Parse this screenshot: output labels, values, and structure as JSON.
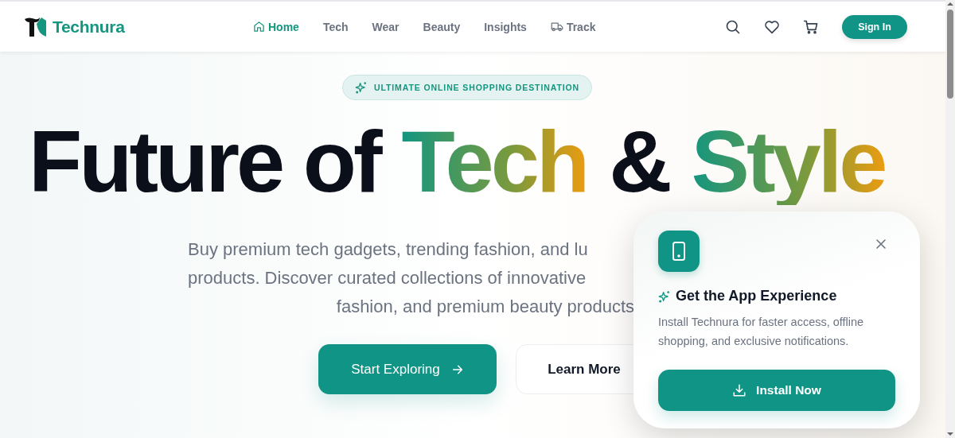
{
  "header": {
    "logo_text": "Technura",
    "nav": [
      {
        "label": "Home",
        "kind": "home",
        "selected": true
      },
      {
        "label": "Tech",
        "kind": "plain",
        "selected": false
      },
      {
        "label": "Wear",
        "kind": "plain",
        "selected": false
      },
      {
        "label": "Beauty",
        "kind": "plain",
        "selected": false
      },
      {
        "label": "Insights",
        "kind": "plain",
        "selected": false
      },
      {
        "label": "Track",
        "kind": "track",
        "selected": false
      }
    ],
    "sign_in": "Sign In"
  },
  "hero": {
    "badge": "ULTIMATE ONLINE SHOPPING DESTINATION",
    "title": [
      {
        "text": "Future of",
        "kind": "plain"
      },
      {
        "text": "Tech",
        "kind": "gradient"
      },
      {
        "text": "&",
        "kind": "plain"
      },
      {
        "text": "Style",
        "kind": "gradient"
      }
    ],
    "description_lines": [
      "Buy premium tech gadgets, trending fashion, and lu",
      "products. Discover curated collections of innovative",
      "fashion, and premium beauty products"
    ],
    "buttons": [
      {
        "label": "Start Exploring",
        "kind": "primary"
      },
      {
        "label": "Learn More",
        "kind": "secondary"
      }
    ]
  },
  "install_prompt": {
    "title": "Get the App Experience",
    "text": "Install Technura for faster access, offline shopping, and exclusive notifications.",
    "button": "Install Now"
  }
}
